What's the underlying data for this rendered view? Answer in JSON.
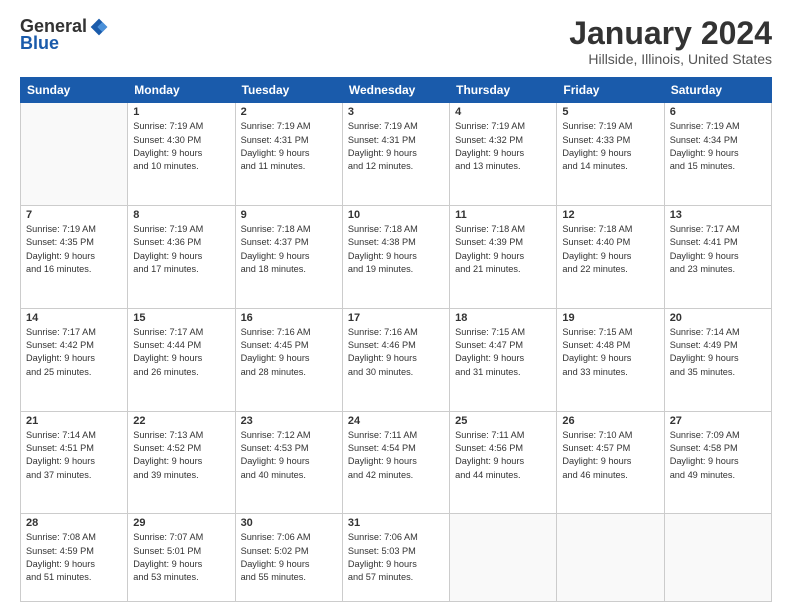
{
  "logo": {
    "general": "General",
    "blue": "Blue"
  },
  "title": "January 2024",
  "location": "Hillside, Illinois, United States",
  "days_of_week": [
    "Sunday",
    "Monday",
    "Tuesday",
    "Wednesday",
    "Thursday",
    "Friday",
    "Saturday"
  ],
  "weeks": [
    [
      {
        "day": "",
        "info": ""
      },
      {
        "day": "1",
        "info": "Sunrise: 7:19 AM\nSunset: 4:30 PM\nDaylight: 9 hours\nand 10 minutes."
      },
      {
        "day": "2",
        "info": "Sunrise: 7:19 AM\nSunset: 4:31 PM\nDaylight: 9 hours\nand 11 minutes."
      },
      {
        "day": "3",
        "info": "Sunrise: 7:19 AM\nSunset: 4:31 PM\nDaylight: 9 hours\nand 12 minutes."
      },
      {
        "day": "4",
        "info": "Sunrise: 7:19 AM\nSunset: 4:32 PM\nDaylight: 9 hours\nand 13 minutes."
      },
      {
        "day": "5",
        "info": "Sunrise: 7:19 AM\nSunset: 4:33 PM\nDaylight: 9 hours\nand 14 minutes."
      },
      {
        "day": "6",
        "info": "Sunrise: 7:19 AM\nSunset: 4:34 PM\nDaylight: 9 hours\nand 15 minutes."
      }
    ],
    [
      {
        "day": "7",
        "info": "Sunrise: 7:19 AM\nSunset: 4:35 PM\nDaylight: 9 hours\nand 16 minutes."
      },
      {
        "day": "8",
        "info": "Sunrise: 7:19 AM\nSunset: 4:36 PM\nDaylight: 9 hours\nand 17 minutes."
      },
      {
        "day": "9",
        "info": "Sunrise: 7:18 AM\nSunset: 4:37 PM\nDaylight: 9 hours\nand 18 minutes."
      },
      {
        "day": "10",
        "info": "Sunrise: 7:18 AM\nSunset: 4:38 PM\nDaylight: 9 hours\nand 19 minutes."
      },
      {
        "day": "11",
        "info": "Sunrise: 7:18 AM\nSunset: 4:39 PM\nDaylight: 9 hours\nand 21 minutes."
      },
      {
        "day": "12",
        "info": "Sunrise: 7:18 AM\nSunset: 4:40 PM\nDaylight: 9 hours\nand 22 minutes."
      },
      {
        "day": "13",
        "info": "Sunrise: 7:17 AM\nSunset: 4:41 PM\nDaylight: 9 hours\nand 23 minutes."
      }
    ],
    [
      {
        "day": "14",
        "info": "Sunrise: 7:17 AM\nSunset: 4:42 PM\nDaylight: 9 hours\nand 25 minutes."
      },
      {
        "day": "15",
        "info": "Sunrise: 7:17 AM\nSunset: 4:44 PM\nDaylight: 9 hours\nand 26 minutes."
      },
      {
        "day": "16",
        "info": "Sunrise: 7:16 AM\nSunset: 4:45 PM\nDaylight: 9 hours\nand 28 minutes."
      },
      {
        "day": "17",
        "info": "Sunrise: 7:16 AM\nSunset: 4:46 PM\nDaylight: 9 hours\nand 30 minutes."
      },
      {
        "day": "18",
        "info": "Sunrise: 7:15 AM\nSunset: 4:47 PM\nDaylight: 9 hours\nand 31 minutes."
      },
      {
        "day": "19",
        "info": "Sunrise: 7:15 AM\nSunset: 4:48 PM\nDaylight: 9 hours\nand 33 minutes."
      },
      {
        "day": "20",
        "info": "Sunrise: 7:14 AM\nSunset: 4:49 PM\nDaylight: 9 hours\nand 35 minutes."
      }
    ],
    [
      {
        "day": "21",
        "info": "Sunrise: 7:14 AM\nSunset: 4:51 PM\nDaylight: 9 hours\nand 37 minutes."
      },
      {
        "day": "22",
        "info": "Sunrise: 7:13 AM\nSunset: 4:52 PM\nDaylight: 9 hours\nand 39 minutes."
      },
      {
        "day": "23",
        "info": "Sunrise: 7:12 AM\nSunset: 4:53 PM\nDaylight: 9 hours\nand 40 minutes."
      },
      {
        "day": "24",
        "info": "Sunrise: 7:11 AM\nSunset: 4:54 PM\nDaylight: 9 hours\nand 42 minutes."
      },
      {
        "day": "25",
        "info": "Sunrise: 7:11 AM\nSunset: 4:56 PM\nDaylight: 9 hours\nand 44 minutes."
      },
      {
        "day": "26",
        "info": "Sunrise: 7:10 AM\nSunset: 4:57 PM\nDaylight: 9 hours\nand 46 minutes."
      },
      {
        "day": "27",
        "info": "Sunrise: 7:09 AM\nSunset: 4:58 PM\nDaylight: 9 hours\nand 49 minutes."
      }
    ],
    [
      {
        "day": "28",
        "info": "Sunrise: 7:08 AM\nSunset: 4:59 PM\nDaylight: 9 hours\nand 51 minutes."
      },
      {
        "day": "29",
        "info": "Sunrise: 7:07 AM\nSunset: 5:01 PM\nDaylight: 9 hours\nand 53 minutes."
      },
      {
        "day": "30",
        "info": "Sunrise: 7:06 AM\nSunset: 5:02 PM\nDaylight: 9 hours\nand 55 minutes."
      },
      {
        "day": "31",
        "info": "Sunrise: 7:06 AM\nSunset: 5:03 PM\nDaylight: 9 hours\nand 57 minutes."
      },
      {
        "day": "",
        "info": ""
      },
      {
        "day": "",
        "info": ""
      },
      {
        "day": "",
        "info": ""
      }
    ]
  ]
}
